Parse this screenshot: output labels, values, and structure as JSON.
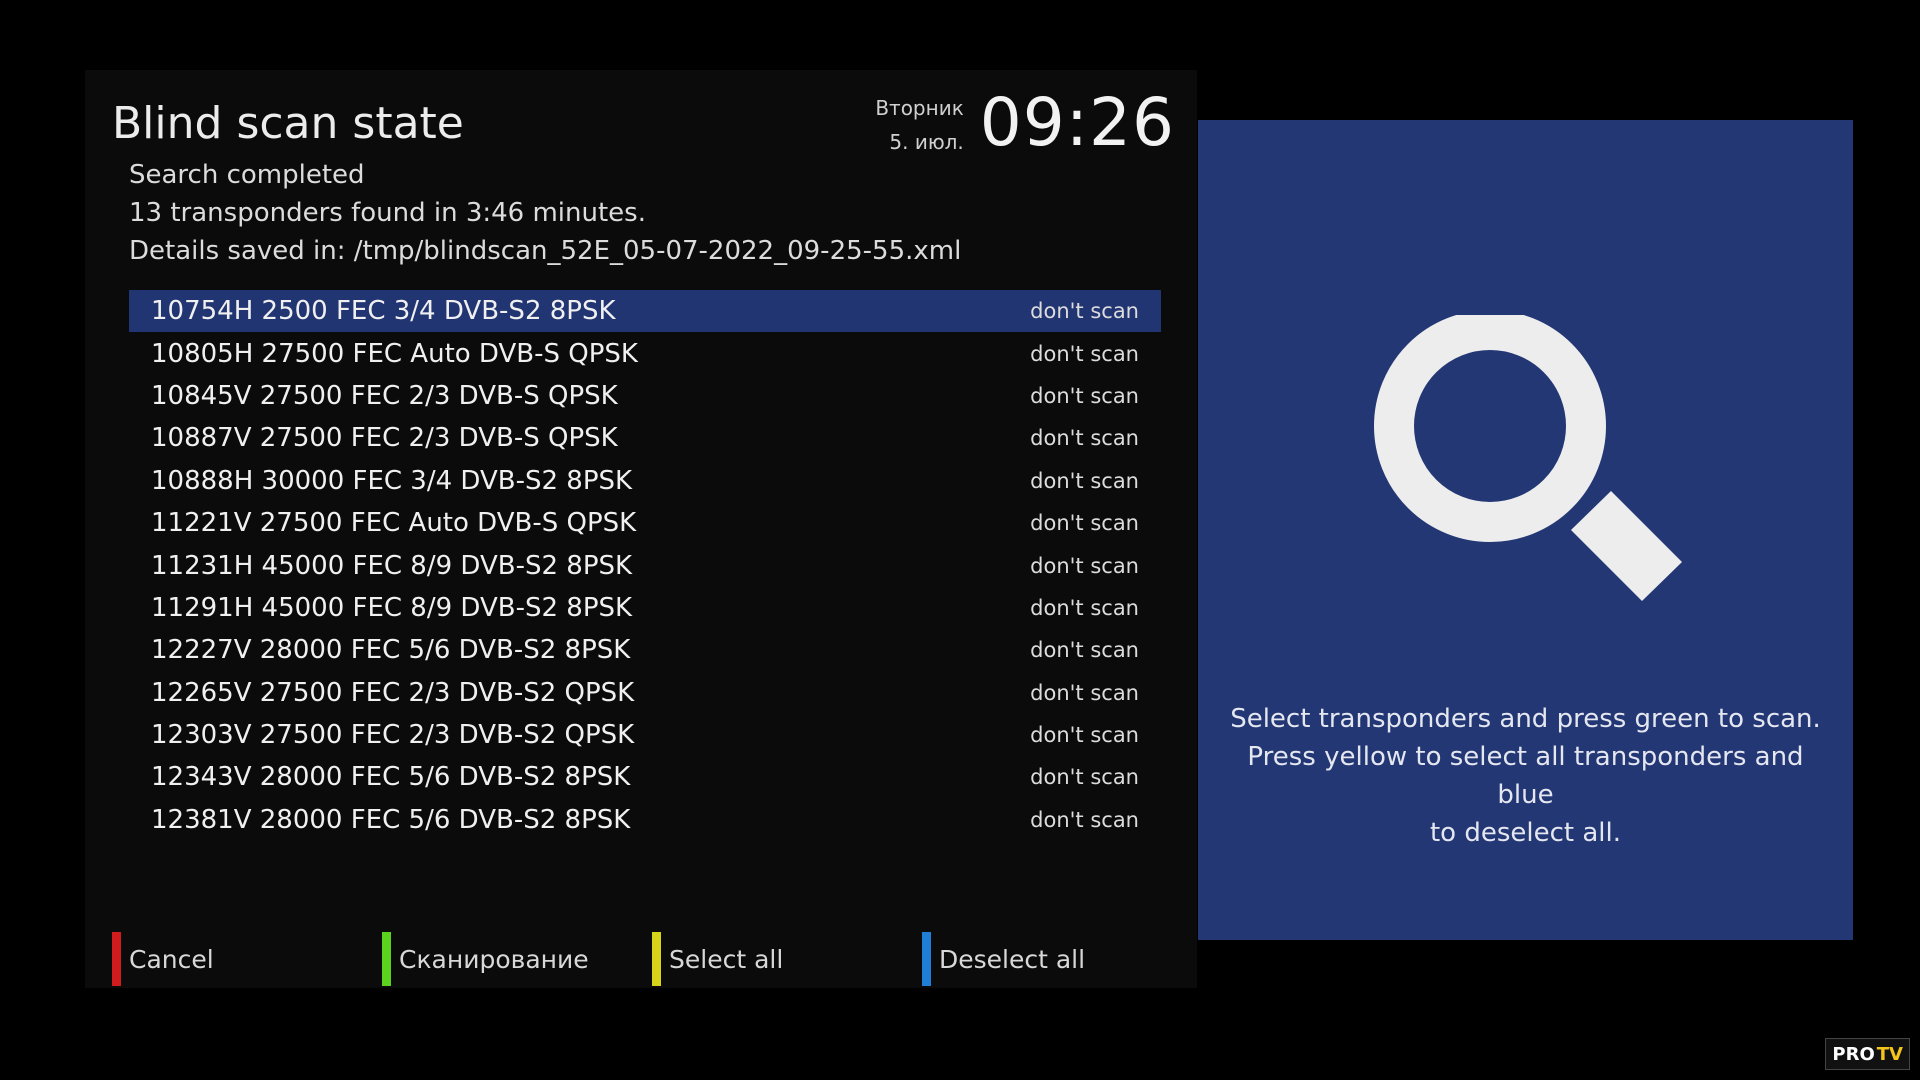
{
  "screen": {
    "title": "Blind scan state",
    "weekday": "Вторник",
    "date": "5. июл.",
    "time": "09:26"
  },
  "info": {
    "status": "Search completed",
    "found": "13 transponders found in 3:46 minutes.",
    "details": "Details saved in: /tmp/blindscan_52E_05-07-2022_09-25-55.xml"
  },
  "transponders": [
    {
      "name": "10754H 2500 FEC 3/4 DVB-S2 8PSK",
      "status": "don't scan",
      "selected": true
    },
    {
      "name": "10805H 27500 FEC Auto DVB-S QPSK",
      "status": "don't scan"
    },
    {
      "name": "10845V 27500 FEC 2/3 DVB-S QPSK",
      "status": "don't scan"
    },
    {
      "name": "10887V 27500 FEC 2/3 DVB-S QPSK",
      "status": "don't scan"
    },
    {
      "name": "10888H 30000 FEC 3/4 DVB-S2 8PSK",
      "status": "don't scan"
    },
    {
      "name": "11221V 27500 FEC Auto DVB-S QPSK",
      "status": "don't scan"
    },
    {
      "name": "11231H 45000 FEC 8/9 DVB-S2 8PSK",
      "status": "don't scan"
    },
    {
      "name": "11291H 45000 FEC 8/9 DVB-S2 8PSK",
      "status": "don't scan"
    },
    {
      "name": "12227V 28000 FEC 5/6 DVB-S2 8PSK",
      "status": "don't scan"
    },
    {
      "name": "12265V 27500 FEC 2/3 DVB-S2 QPSK",
      "status": "don't scan"
    },
    {
      "name": "12303V 27500 FEC 2/3 DVB-S2 QPSK",
      "status": "don't scan"
    },
    {
      "name": "12343V 28000 FEC 5/6 DVB-S2 8PSK",
      "status": "don't scan"
    },
    {
      "name": "12381V 28000 FEC 5/6 DVB-S2 8PSK",
      "status": "don't scan"
    }
  ],
  "footer": {
    "cancel": {
      "label": "Cancel",
      "color": "#d01c1c"
    },
    "scan": {
      "label": "Сканирование",
      "color": "#5ad21e"
    },
    "select_all": {
      "label": "Select all",
      "color": "#d7d21a"
    },
    "deselect_all": {
      "label": "Deselect all",
      "color": "#1f7fd6"
    }
  },
  "help": {
    "icon": "magnifier-icon",
    "line1": "Select transponders and press green to scan.",
    "line2": "Press yellow to select all transponders and blue",
    "line3": "to deselect all.",
    "background": "#233774"
  },
  "watermark": {
    "brand": "PRO",
    "brand_accent": "TV"
  },
  "colors": {
    "selection": "#223573",
    "panel": "#0b0b0b",
    "help_panel": "#233774"
  }
}
